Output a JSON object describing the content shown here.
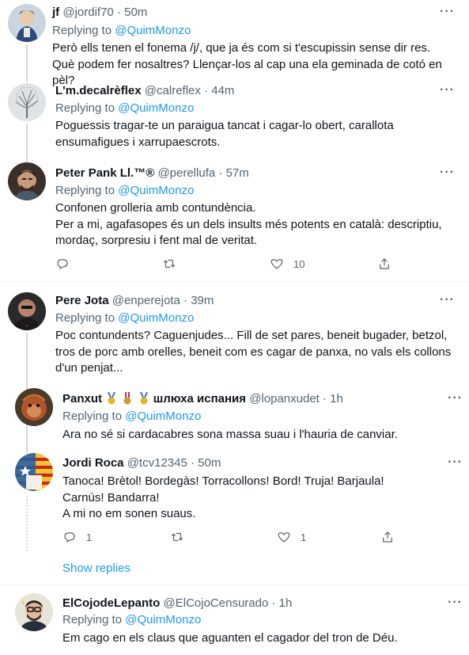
{
  "replying_prefix": "Replying to",
  "replying_mention": "@QuimMonzo",
  "more_glyph": "···",
  "tweets": [
    {
      "name": "jf",
      "handle": "@jordif70",
      "time": "50m",
      "body": "Però ells tenen el fonema /j/, que ja és com si t'escupissin sense dir res. Què podem fer nosaltres? Llençar-los al cap una ela geminada de cotó en pèl?"
    },
    {
      "name": "L'm.decalrèflex",
      "handle": "@calreflex",
      "time": "44m",
      "body": "Poguessis tragar-te un paraigua tancat i cagar-lo obert, carallota ensumafigues i xarrupaescrots."
    },
    {
      "name": "Peter Pank Ll.™®",
      "handle": "@perellufa",
      "time": "57m",
      "body_lines": [
        "Confonen grolleria amb contundència.",
        "Per a mi, agafasopes és un dels insults més potents en català: descriptiu, mordaç, sorpresiu i fent mal de veritat."
      ],
      "like_count": "10"
    },
    {
      "name": "Pere Jota",
      "handle": "@enperejota",
      "time": "39m",
      "body": "Poc contundents? Caguenjudes... Fill de set pares, beneit bugader, betzol, tros de porc amb orelles, beneit com es cagar de panxa, no vals els collons d'un penjat..."
    },
    {
      "name": "Panxut",
      "name_suffix": "шлюха испания",
      "handle": "@lopanxudet",
      "time": "1h",
      "body": "Ara no sé si cardacabres sona massa suau i l'hauria de canviar."
    },
    {
      "name": "Jordi Roca",
      "handle": "@tcv12345",
      "time": "50m",
      "body_lines": [
        "Tanoca! Brètol! Bordegàs! Torracollons! Bord! Truja! Barjaula! Carnús! Bandarra!",
        "A mi no em sonen suaus."
      ],
      "reply_count": "1",
      "like_count": "1"
    },
    {
      "name": "ElCojodeLepanto",
      "handle": "@ElCojoCensurado",
      "time": "1h",
      "body": "Em cago en els claus que aguanten el cagador del tron de Déu."
    }
  ],
  "show_replies": "Show replies",
  "colors": {
    "accent": "#1d9bf0",
    "muted": "#536471",
    "text": "#0f1419",
    "line": "#cfd9de"
  }
}
